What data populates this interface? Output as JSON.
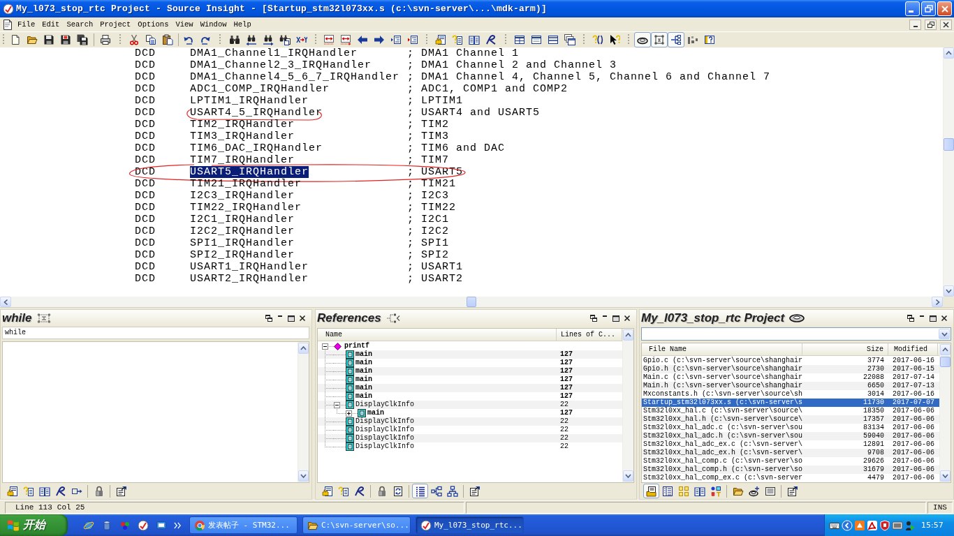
{
  "window": {
    "title": "My_l073_stop_rtc Project - Source Insight - [Startup_stm32l073xx.s (c:\\svn-server\\...\\mdk-arm)]"
  },
  "menu": [
    "File",
    "Edit",
    "Search",
    "Project",
    "Options",
    "View",
    "Window",
    "Help"
  ],
  "toolbar": [
    {
      "on": false
    },
    {
      "on": false
    },
    {
      "on": false
    },
    {
      "on": false
    },
    {
      "on": false
    },
    {
      "on": false
    },
    {
      "on": false
    },
    {
      "on": false
    },
    {
      "on": false
    },
    {
      "on": false
    },
    {
      "on": false
    },
    {
      "on": false
    },
    {
      "on": false
    },
    {
      "on": false
    },
    {
      "on": false
    },
    {
      "on": false
    },
    {
      "on": false
    },
    {
      "on": false
    },
    {
      "on": false
    },
    {
      "on": false
    },
    {
      "on": false
    },
    {
      "on": false
    },
    {
      "on": false
    },
    {
      "on": false
    },
    {
      "on": false
    },
    {
      "on": false
    },
    {
      "on": false
    },
    {
      "on": false
    },
    {
      "on": false
    },
    {
      "on": false
    },
    {
      "on": false
    },
    {
      "on": false
    },
    {
      "on": true
    },
    {
      "on": true
    },
    {
      "on": true
    },
    {
      "on": false
    },
    {
      "on": false
    }
  ],
  "editor": {
    "lines": [
      {
        "directive": "DCD",
        "operand": "DMA1_Channel1_IRQHandler",
        "comment": "; DMA1 Channel 1",
        "selected": false,
        "operand_circled": false,
        "row_circled": false
      },
      {
        "directive": "DCD",
        "operand": "DMA1_Channel2_3_IRQHandler",
        "comment": "; DMA1 Channel 2 and Channel 3",
        "selected": false,
        "operand_circled": false,
        "row_circled": false
      },
      {
        "directive": "DCD",
        "operand": "DMA1_Channel4_5_6_7_IRQHandler",
        "comment": "; DMA1 Channel 4, Channel 5, Channel 6 and Channel 7",
        "selected": false,
        "operand_circled": false,
        "row_circled": false
      },
      {
        "directive": "DCD",
        "operand": "ADC1_COMP_IRQHandler",
        "comment": "; ADC1, COMP1 and COMP2",
        "selected": false,
        "operand_circled": false,
        "row_circled": false
      },
      {
        "directive": "DCD",
        "operand": "LPTIM1_IRQHandler",
        "comment": "; LPTIM1",
        "selected": false,
        "operand_circled": false,
        "row_circled": false
      },
      {
        "directive": "DCD",
        "operand": "USART4_5_IRQHandler",
        "comment": "; USART4 and USART5",
        "selected": false,
        "operand_circled": true,
        "row_circled": false
      },
      {
        "directive": "DCD",
        "operand": "TIM2_IRQHandler",
        "comment": "; TIM2",
        "selected": false,
        "operand_circled": false,
        "row_circled": false
      },
      {
        "directive": "DCD",
        "operand": "TIM3_IRQHandler",
        "comment": "; TIM3",
        "selected": false,
        "operand_circled": false,
        "row_circled": false
      },
      {
        "directive": "DCD",
        "operand": "TIM6_DAC_IRQHandler",
        "comment": "; TIM6 and DAC",
        "selected": false,
        "operand_circled": false,
        "row_circled": false
      },
      {
        "directive": "DCD",
        "operand": "TIM7_IRQHandler",
        "comment": "; TIM7",
        "selected": false,
        "operand_circled": false,
        "row_circled": false
      },
      {
        "directive": "DCD",
        "operand": "USART5_IRQHandler",
        "comment": "; USART5",
        "selected": true,
        "operand_circled": false,
        "row_circled": true
      },
      {
        "directive": "DCD",
        "operand": "TIM21_IRQHandler",
        "comment": "; TIM21",
        "selected": false,
        "operand_circled": false,
        "row_circled": false
      },
      {
        "directive": "DCD",
        "operand": "I2C3_IRQHandler",
        "comment": "; I2C3",
        "selected": false,
        "operand_circled": false,
        "row_circled": false
      },
      {
        "directive": "DCD",
        "operand": "TIM22_IRQHandler",
        "comment": "; TIM22",
        "selected": false,
        "operand_circled": false,
        "row_circled": false
      },
      {
        "directive": "DCD",
        "operand": "I2C1_IRQHandler",
        "comment": "; I2C1",
        "selected": false,
        "operand_circled": false,
        "row_circled": false
      },
      {
        "directive": "DCD",
        "operand": "I2C2_IRQHandler",
        "comment": "; I2C2",
        "selected": false,
        "operand_circled": false,
        "row_circled": false
      },
      {
        "directive": "DCD",
        "operand": "SPI1_IRQHandler",
        "comment": "; SPI1",
        "selected": false,
        "operand_circled": false,
        "row_circled": false
      },
      {
        "directive": "DCD",
        "operand": "SPI2_IRQHandler",
        "comment": "; SPI2",
        "selected": false,
        "operand_circled": false,
        "row_circled": false
      },
      {
        "directive": "DCD",
        "operand": "USART1_IRQHandler",
        "comment": "; USART1",
        "selected": false,
        "operand_circled": false,
        "row_circled": false
      },
      {
        "directive": "DCD",
        "operand": "USART2_IRQHandler",
        "comment": "; USART2",
        "selected": false,
        "operand_circled": false,
        "row_circled": false
      }
    ]
  },
  "symbol_panel": {
    "title": "while",
    "search": {
      "value": "while"
    },
    "toolbar": [
      {
        "on": false
      },
      {
        "on": false
      },
      {
        "on": false
      },
      {
        "on": false
      },
      {
        "on": false
      },
      {
        "on": false
      },
      {
        "on": false
      }
    ]
  },
  "references_panel": {
    "title": "References",
    "columns": [
      "Name",
      "Lines of C..."
    ],
    "tree": [
      {
        "name": "printf",
        "kind": "symbol",
        "bold": true,
        "expanded": true,
        "children": [
          {
            "name": "main",
            "kind": "function",
            "bold": true,
            "lines": "127"
          },
          {
            "name": "main",
            "kind": "function",
            "bold": true,
            "lines": "127"
          },
          {
            "name": "main",
            "kind": "function",
            "bold": true,
            "lines": "127"
          },
          {
            "name": "main",
            "kind": "function",
            "bold": true,
            "lines": "127"
          },
          {
            "name": "main",
            "kind": "function",
            "bold": true,
            "lines": "127"
          },
          {
            "name": "main",
            "kind": "function",
            "bold": true,
            "lines": "127"
          },
          {
            "name": "DisplayClkInfo",
            "kind": "function",
            "bold": false,
            "lines": "22",
            "expanded": true,
            "children": [
              {
                "name": "main",
                "kind": "function",
                "bold": true,
                "lines": "127",
                "expanded": false
              }
            ]
          },
          {
            "name": "DisplayClkInfo",
            "kind": "function",
            "bold": false,
            "lines": "22"
          },
          {
            "name": "DisplayClkInfo",
            "kind": "function",
            "bold": false,
            "lines": "22"
          },
          {
            "name": "DisplayClkInfo",
            "kind": "function",
            "bold": false,
            "lines": "22"
          },
          {
            "name": "DisplayClkInfo",
            "kind": "function",
            "bold": false,
            "lines": "22"
          }
        ]
      }
    ],
    "toolbar": [
      {
        "on": false
      },
      {
        "on": false
      },
      {
        "on": false
      },
      {
        "on": false
      },
      {
        "on": false
      },
      {
        "on": true
      },
      {
        "on": false
      },
      {
        "on": false
      },
      {
        "on": false
      }
    ]
  },
  "project_panel": {
    "title": "My_l073_stop_rtc Project",
    "columns": [
      "File Name",
      "Size",
      "Modified"
    ],
    "files": [
      {
        "name": "Gpio.c (c:\\svn-server\\source\\shanghair",
        "size": "3774",
        "modified": "2017-06-16",
        "selected": false
      },
      {
        "name": "Gpio.h (c:\\svn-server\\source\\shanghair",
        "size": "2730",
        "modified": "2017-06-15",
        "selected": false
      },
      {
        "name": "Main.c (c:\\svn-server\\source\\shanghair",
        "size": "22088",
        "modified": "2017-07-14",
        "selected": false
      },
      {
        "name": "Main.h (c:\\svn-server\\source\\shanghair",
        "size": "6650",
        "modified": "2017-07-13",
        "selected": false
      },
      {
        "name": "Mxconstants.h (c:\\svn-server\\source\\sh",
        "size": "3014",
        "modified": "2017-06-16",
        "selected": false
      },
      {
        "name": "Startup_stm32l073xx.s (c:\\svn-server\\s",
        "size": "11730",
        "modified": "2017-07-07",
        "selected": true
      },
      {
        "name": "Stm32l0xx_hal.c (c:\\svn-server\\source\\",
        "size": "18350",
        "modified": "2017-06-06",
        "selected": false
      },
      {
        "name": "Stm32l0xx_hal.h (c:\\svn-server\\source\\",
        "size": "17357",
        "modified": "2017-06-06",
        "selected": false
      },
      {
        "name": "Stm32l0xx_hal_adc.c (c:\\svn-server\\sou",
        "size": "83134",
        "modified": "2017-06-06",
        "selected": false
      },
      {
        "name": "Stm32l0xx_hal_adc.h (c:\\svn-server\\sou",
        "size": "59040",
        "modified": "2017-06-06",
        "selected": false
      },
      {
        "name": "Stm32l0xx_hal_adc_ex.c (c:\\svn-server\\",
        "size": "12891",
        "modified": "2017-06-06",
        "selected": false
      },
      {
        "name": "Stm32l0xx_hal_adc_ex.h (c:\\svn-server\\",
        "size": "9708",
        "modified": "2017-06-06",
        "selected": false
      },
      {
        "name": "Stm32l0xx_hal_comp.c (c:\\svn-server\\so",
        "size": "29626",
        "modified": "2017-06-06",
        "selected": false
      },
      {
        "name": "Stm32l0xx_hal_comp.h (c:\\svn-server\\so",
        "size": "31679",
        "modified": "2017-06-06",
        "selected": false
      },
      {
        "name": "Stm32l0xx_hal_comp_ex.c (c:\\svn-server",
        "size": "4479",
        "modified": "2017-06-06",
        "selected": false
      }
    ],
    "toolbar": [
      {
        "on": true
      },
      {
        "on": false
      },
      {
        "on": false
      },
      {
        "on": false
      },
      {
        "on": false
      },
      {
        "on": false
      },
      {
        "on": false
      },
      {
        "on": false
      },
      {
        "on": false
      }
    ]
  },
  "status_bar": {
    "line": "Line 113",
    "column": "Col 25",
    "mode": "INS"
  },
  "taskbar": {
    "start": "开始",
    "tasks": [
      {
        "label": "发表帖子 - STM32...",
        "selected": false
      },
      {
        "label": "C:\\svn-server\\so...",
        "selected": false
      },
      {
        "label": "My_l073_stop_rtc...",
        "selected": true
      }
    ],
    "clock": "15:57"
  }
}
